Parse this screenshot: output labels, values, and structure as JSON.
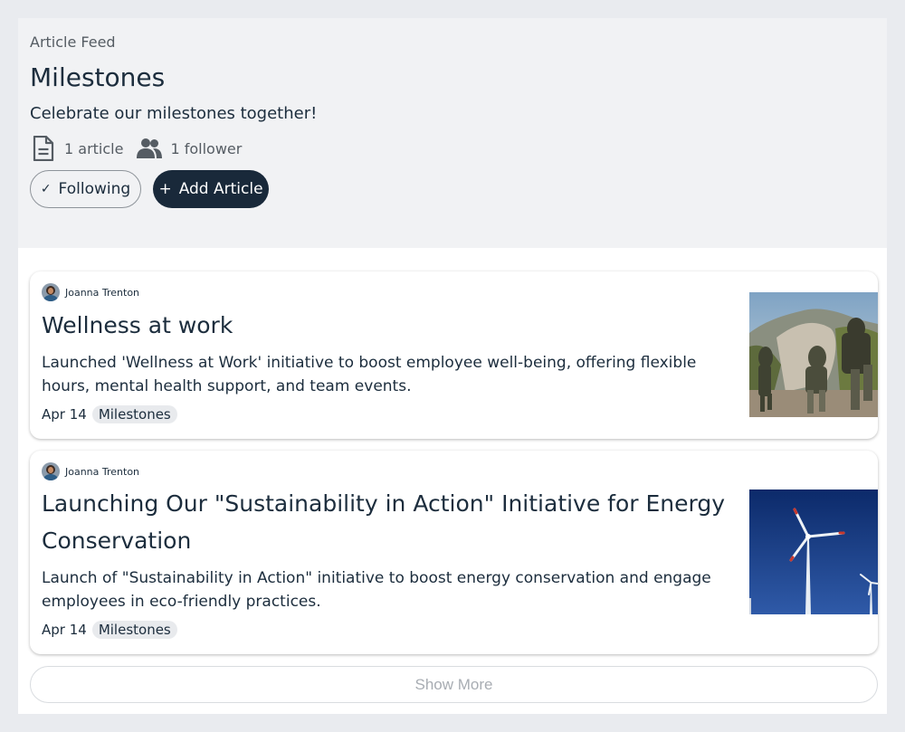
{
  "header": {
    "eyebrow": "Article Feed",
    "title": "Milestones",
    "subtitle": "Celebrate our milestones together!",
    "stats": {
      "articles": "1 article",
      "followers": "1 follower"
    },
    "following_label": "Following",
    "add_article_label": "Add Article"
  },
  "articles": [
    {
      "author": "Joanna Trenton",
      "title": "Wellness at work",
      "description": "Launched 'Wellness at Work' initiative to boost employee well-being, offering flexible hours, mental health support, and team events.",
      "date": "Apr 14",
      "tag": "Milestones",
      "thumbnail": "hikers-image"
    },
    {
      "author": "Joanna Trenton",
      "title": "Launching Our \"Sustainability in Action\" Initiative for Energy Conservation",
      "description": "Launch of \"Sustainability in Action\" initiative to boost energy conservation and engage employees in eco-friendly practices.",
      "date": "Apr 14",
      "tag": "Milestones",
      "thumbnail": "wind-turbines-image"
    }
  ],
  "show_more_label": "Show More",
  "colors": {
    "background": "#e9ebef",
    "header_bg": "#f1f2f4",
    "primary_dark": "#19293a",
    "text": "#1c2d3d",
    "muted": "#555c63"
  }
}
